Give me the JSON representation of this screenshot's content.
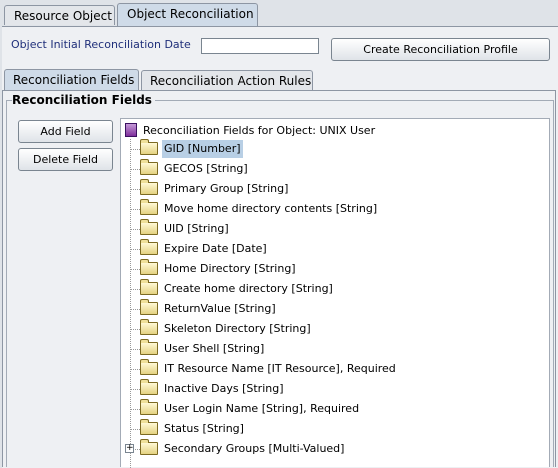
{
  "top_tabs": {
    "resource_object": "Resource Object",
    "object_reconciliation": "Object Reconciliation"
  },
  "initial_recon_date_label": "Object Initial Reconciliation Date",
  "initial_recon_date_value": "",
  "create_profile_button": "Create Reconciliation Profile",
  "inner_tabs": {
    "reconciliation_fields": "Reconciliation Fields",
    "reconciliation_action_rules": "Reconciliation Action Rules"
  },
  "group_title": "Reconciliation Fields",
  "add_field_button": "Add Field",
  "delete_field_button": "Delete Field",
  "tree": {
    "root_label": "Reconciliation Fields for Object: UNIX User",
    "items": [
      "GID [Number]",
      "GECOS [String]",
      "Primary Group [String]",
      "Move home directory contents [String]",
      "UID [String]",
      "Expire Date [Date]",
      "Home Directory [String]",
      "Create home directory [String]",
      "ReturnValue [String]",
      "Skeleton Directory [String]",
      "User Shell [String]",
      "IT Resource Name [IT Resource], Required",
      "Inactive Days [String]",
      "User Login Name [String], Required",
      "Status [String]",
      "Secondary Groups [Multi-Valued]"
    ]
  },
  "colors": {
    "selection": "#b8cfe5",
    "label_blue": "#1f2f7a"
  }
}
